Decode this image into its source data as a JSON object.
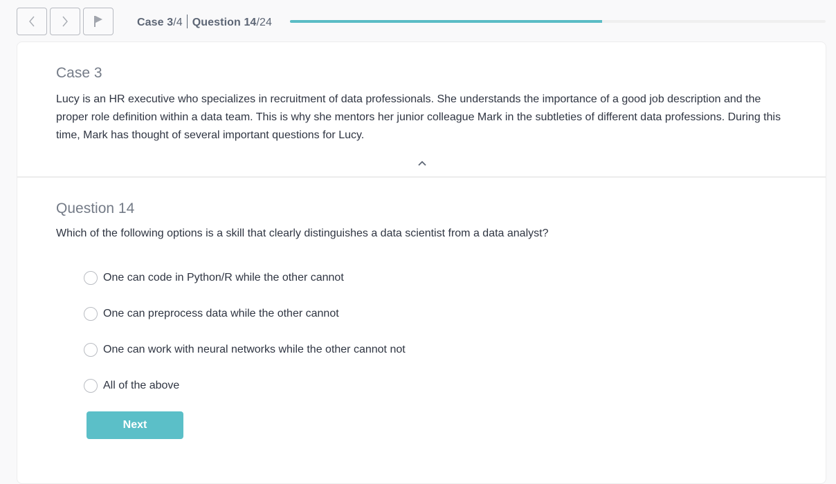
{
  "header": {
    "nav_buttons": [
      {
        "icon": "chevron-left-icon"
      },
      {
        "icon": "chevron-right-icon"
      },
      {
        "icon": "flag-icon"
      }
    ],
    "progress": {
      "case_label": "Case",
      "case_current": "3",
      "case_total": "/4",
      "question_label": "Question",
      "question_current": "14",
      "question_total": "/24",
      "fraction": 0.583
    }
  },
  "case": {
    "title": "Case 3",
    "text": "Lucy is an HR executive who specializes in recruitment of data professionals. She understands the importance of a good job description and the proper role definition within a data team. This is why she mentors her junior colleague Mark in the subtleties of different data professions. During this time, Mark has thought of several important questions for Lucy.",
    "toggle_icon": "chevron-up-icon"
  },
  "question": {
    "title": "Question 14",
    "text": "Which of the following options is a skill that clearly distinguishes a data scientist from a data analyst?",
    "options": [
      {
        "label": "One can code in Python/R while the other cannot",
        "selected": false
      },
      {
        "label": "One can preprocess data while the other cannot",
        "selected": false
      },
      {
        "label": "One can work with neural networks while the other cannot not",
        "selected": false
      },
      {
        "label": "All of the above",
        "selected": false
      }
    ]
  },
  "actions": {
    "next_label": "Next"
  },
  "colors": {
    "accent": "#5bbfc8",
    "progress_fill": "#5bbcc5",
    "progress_track": "#efefef",
    "text": "#2f3542",
    "muted_title": "#747b87"
  }
}
